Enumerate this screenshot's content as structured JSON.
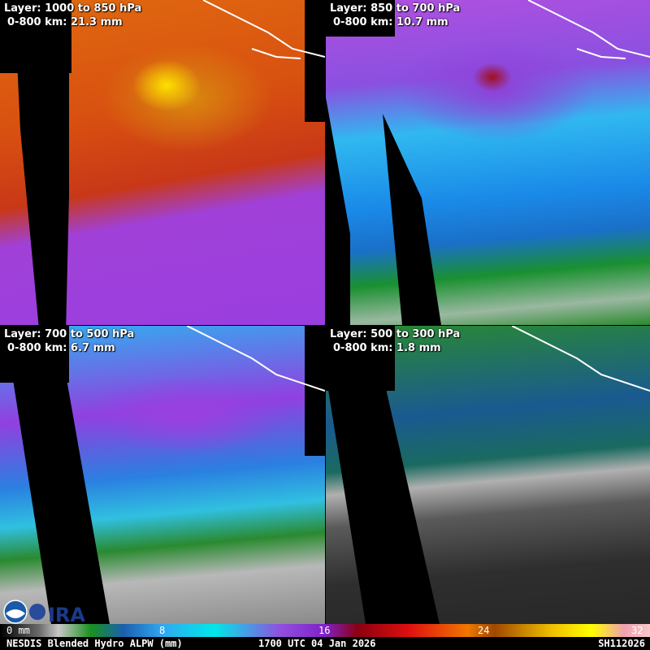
{
  "panels": [
    {
      "layer": "Layer: 1000 to 850 hPa",
      "mean": "0-800 km: 21.3 mm"
    },
    {
      "layer": "Layer: 850 to 700 hPa",
      "mean": "0-800 km: 10.7 mm"
    },
    {
      "layer": "Layer: 700 to 500 hPa",
      "mean": "0-800 km: 6.7 mm"
    },
    {
      "layer": "Layer: 500 to 300 hPa",
      "mean": "0-800 km: 1.8 mm"
    }
  ],
  "colorbar": {
    "ticks": [
      "0 mm",
      "8",
      "16",
      "24",
      "32"
    ]
  },
  "footer": {
    "product": "NESDIS Blended Hydro ALPW (mm)",
    "time": "1700 UTC 04 Jan 2026",
    "id": "SH112026"
  },
  "logos": [
    "NOAA",
    "CIRA"
  ]
}
